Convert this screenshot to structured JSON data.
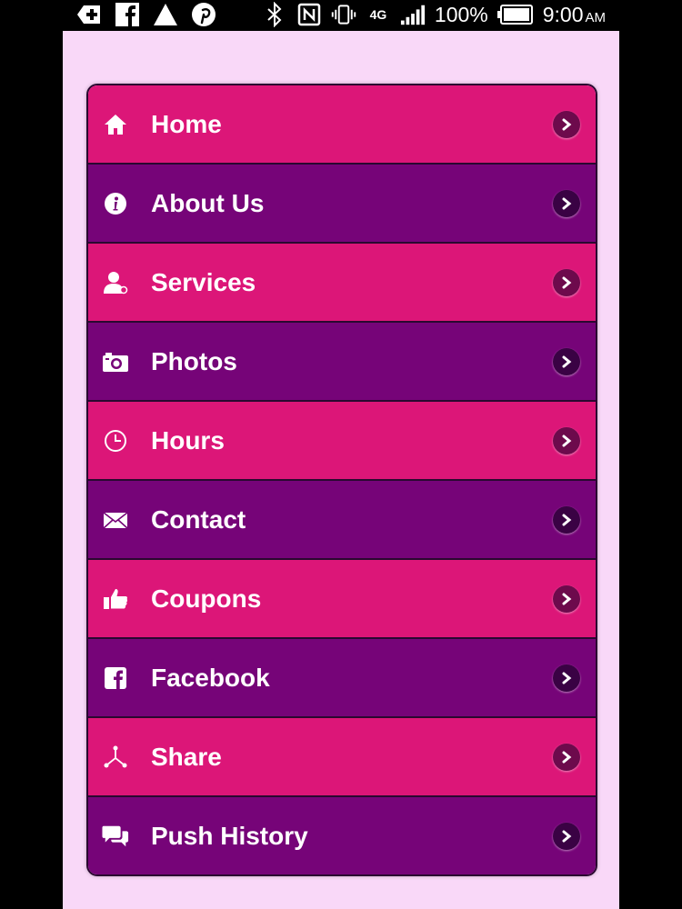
{
  "status_bar": {
    "battery_percent": "100%",
    "time": "9:00",
    "time_suffix": "AM",
    "network": "4G"
  },
  "colors": {
    "pink_row": "#dc1678",
    "purple_row": "#760478",
    "app_background": "#f9d8f8"
  },
  "menu": {
    "items": [
      {
        "label": "Home",
        "icon": "home-icon"
      },
      {
        "label": "About Us",
        "icon": "info-icon"
      },
      {
        "label": "Services",
        "icon": "person-icon"
      },
      {
        "label": "Photos",
        "icon": "camera-icon"
      },
      {
        "label": "Hours",
        "icon": "clock-icon"
      },
      {
        "label": "Contact",
        "icon": "envelope-icon"
      },
      {
        "label": "Coupons",
        "icon": "thumbs-up-icon"
      },
      {
        "label": "Facebook",
        "icon": "facebook-icon"
      },
      {
        "label": "Share",
        "icon": "share-icon"
      },
      {
        "label": "Push History",
        "icon": "chat-bubbles-icon"
      }
    ]
  }
}
